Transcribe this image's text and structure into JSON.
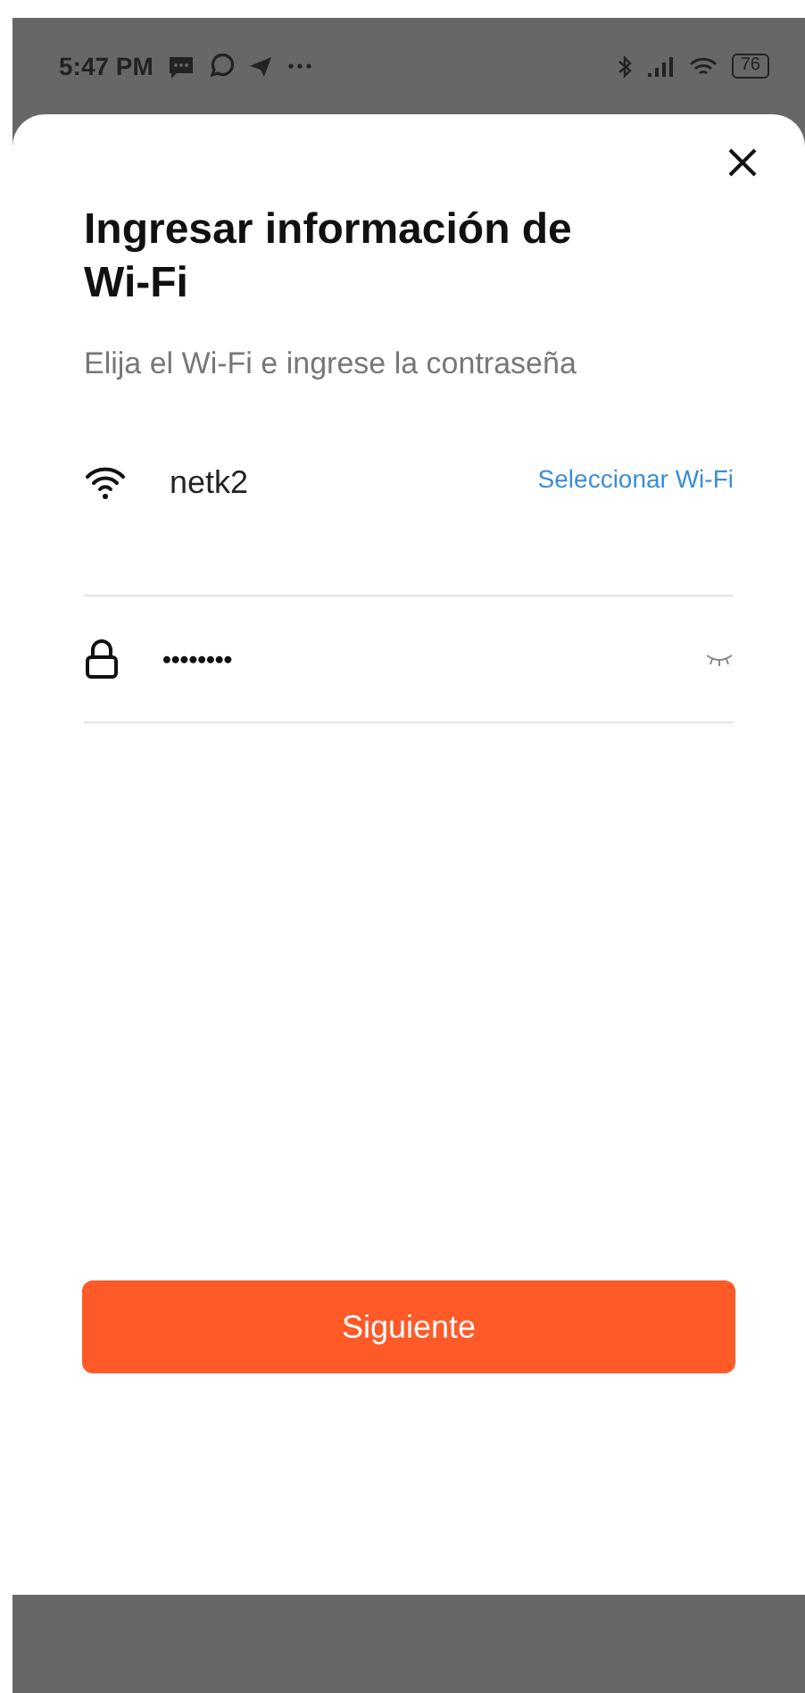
{
  "status_bar": {
    "time": "5:47 PM",
    "battery": "76"
  },
  "sheet": {
    "title": "Ingresar información de Wi-Fi",
    "subtitle": "Elija el Wi-Fi e ingrese la contraseña",
    "wifi": {
      "value": "netk2",
      "link": "Seleccionar Wi-Fi"
    },
    "password": {
      "value": "••••••••"
    },
    "button": "Siguiente"
  }
}
